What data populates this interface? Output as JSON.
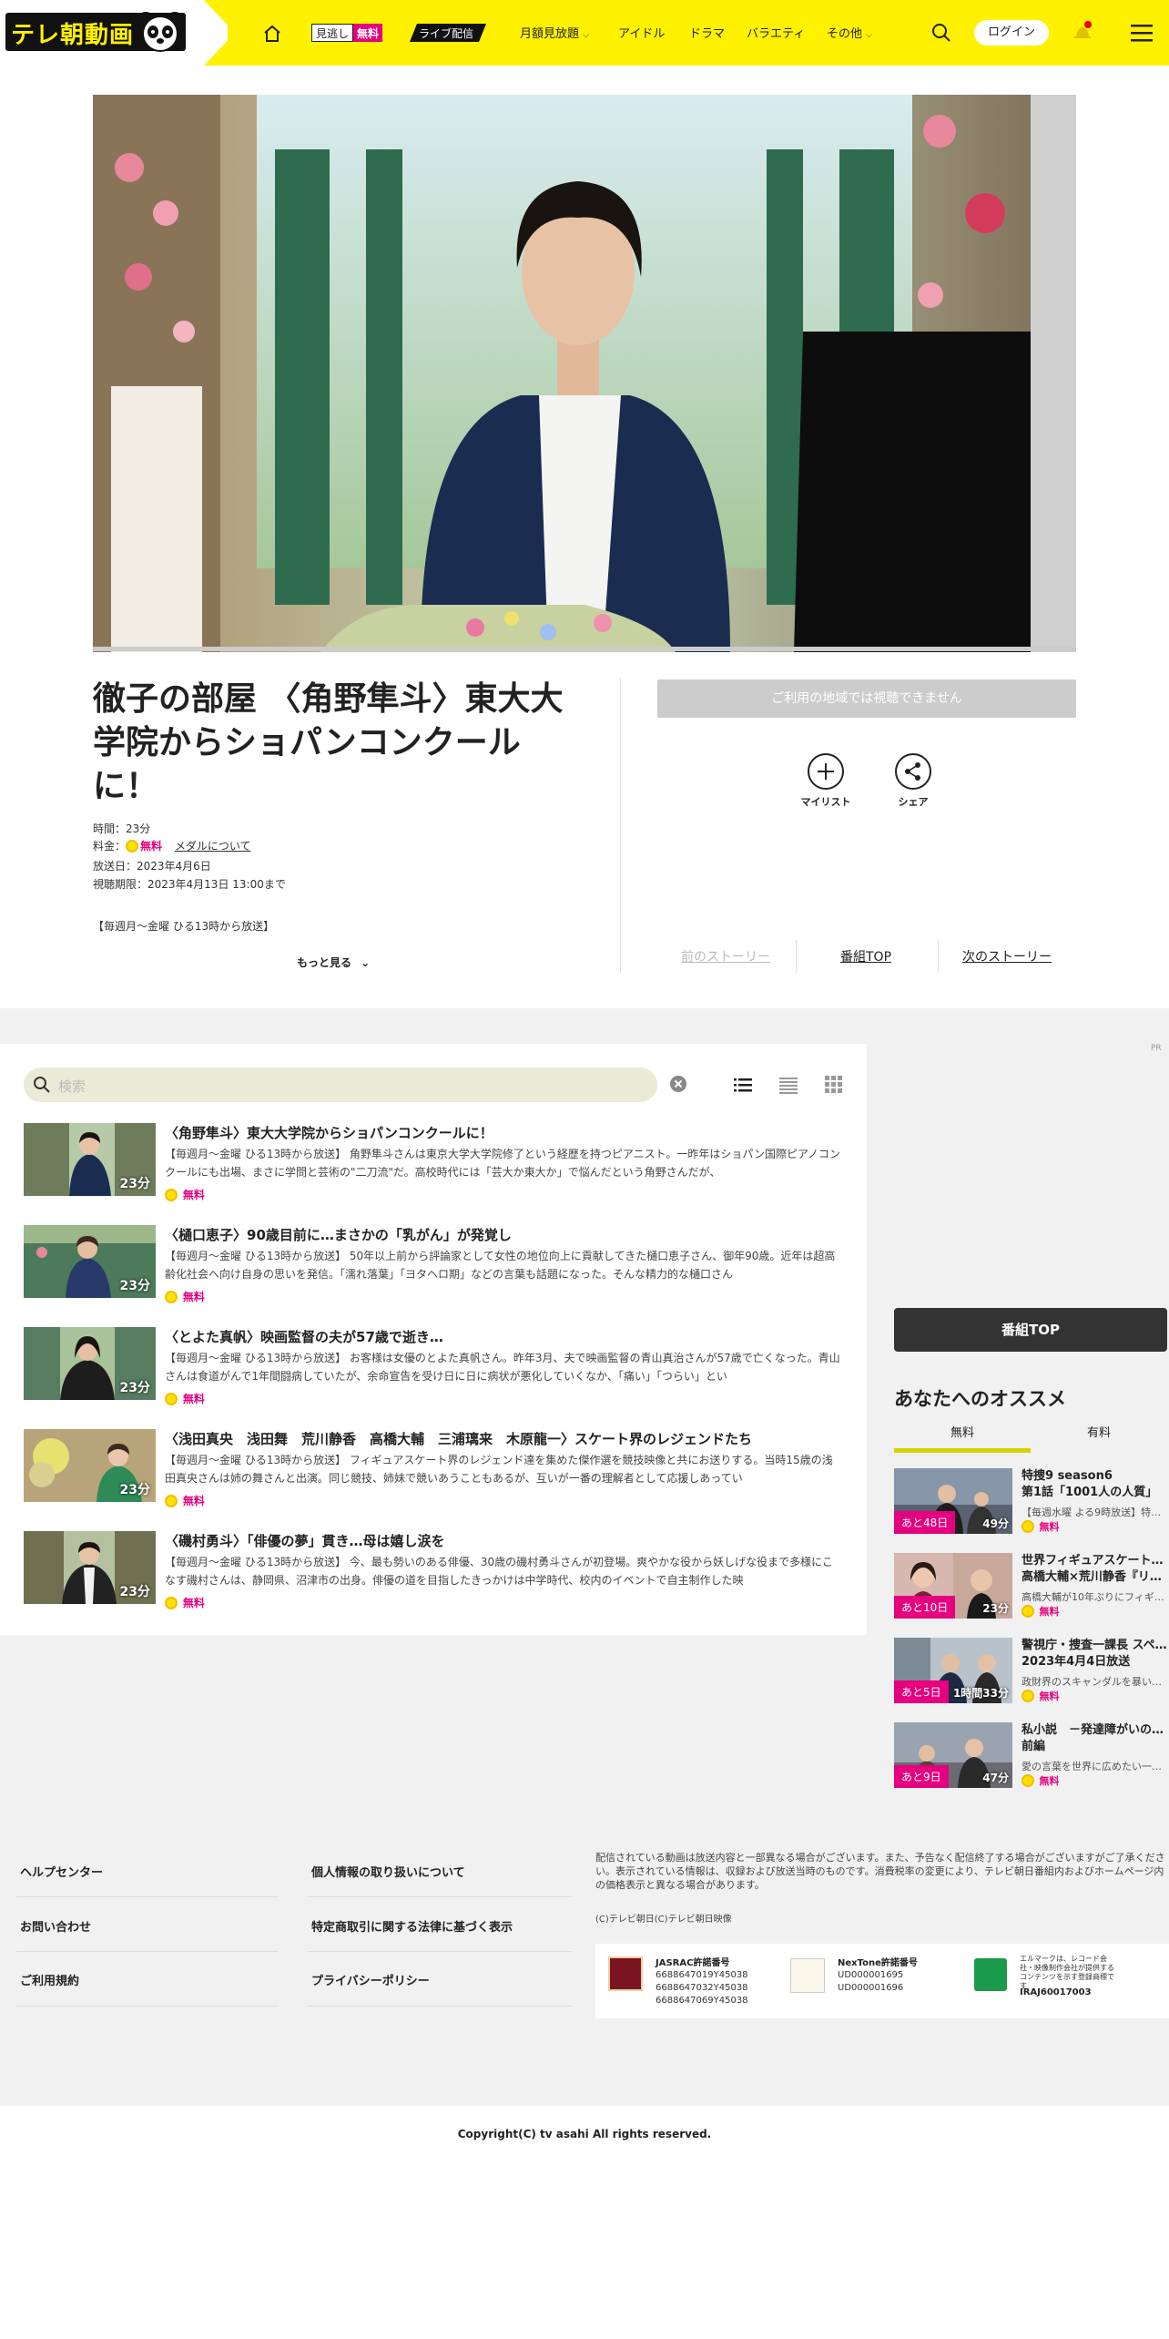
{
  "header": {
    "logo": "テレ朝動画",
    "mino": "見逃し",
    "mino_free": "無料",
    "live": "ライブ配信",
    "nav": [
      "月額見放題",
      "アイドル",
      "ドラマ",
      "バラエティ",
      "その他"
    ],
    "login": "ログイン",
    "colors": {
      "accent": "#fff100",
      "free": "#e4007f"
    }
  },
  "episode": {
    "title": "徹子の部屋 〈角野隼斗〉東大大学院からショパンコンクールに！",
    "time": "時間：23分",
    "price_label": "料金：",
    "price": "無料",
    "medal_link": "メダルについて",
    "air_date": "放送日：2023年4月6日",
    "expiry": "視聴期限：2023年4月13日 13:00まで",
    "schedule": "【毎週月～金曜 ひる13時から放送】",
    "more": "もっと見る",
    "unavailable": "ご利用の地域では視聴できません",
    "mylist": "マイリスト",
    "share": "シェア",
    "prev": "前のストーリー",
    "top": "番組TOP",
    "next": "次のストーリー"
  },
  "list": {
    "placeholder": "検索",
    "items": [
      {
        "title": "〈角野隼斗〉東大大学院からショパンコンクールに！",
        "desc": "【毎週月～金曜 ひる13時から放送】 角野隼斗さんは東京大学大学院修了という経歴を持つピアニスト。一昨年はショパン国際ピアノコンクールにも出場、まさに学問と芸術の\"二刀流\"だ。高校時代には「芸大か東大か」で悩んだという角野さんだが、",
        "duration": "23分",
        "price": "無料"
      },
      {
        "title": "〈樋口恵子〉90歳目前に…まさかの「乳がん」が発覚し",
        "desc": "【毎週月～金曜 ひる13時から放送】 50年以上前から評論家として女性の地位向上に貢献してきた樋口恵子さん、御年90歳。近年は超高齢化社会へ向け自身の思いを発信。「濡れ落葉」「ヨタヘロ期」などの言葉も話題になった。そんな精力的な樋口さん",
        "duration": "23分",
        "price": "無料"
      },
      {
        "title": "〈とよた真帆〉映画監督の夫が57歳で逝き…",
        "desc": "【毎週月～金曜 ひる13時から放送】 お客様は女優のとよた真帆さん。昨年3月、夫で映画監督の青山真治さんが57歳で亡くなった。青山さんは食道がんで1年間闘病していたが、余命宣告を受け日に日に病状が悪化していくなか、「痛い」「つらい」とい",
        "duration": "23分",
        "price": "無料"
      },
      {
        "title": "〈浅田真央　浅田舞　荒川静香　高橋大輔　三浦璃来　木原龍一〉スケート界のレジェンドたち",
        "desc": "【毎週月～金曜 ひる13時から放送】 フィギュアスケート界のレジェンド達を集めた傑作選を競技映像と共にお送りする。当時15歳の浅田真央さんは姉の舞さんと出演。同じ競技、姉妹で競いあうこともあるが、互いが一番の理解者として応援しあってい",
        "duration": "23分",
        "price": "無料"
      },
      {
        "title": "〈磯村勇斗〉「俳優の夢」貫き…母は嬉し涙を",
        "desc": "【毎週月～金曜 ひる13時から放送】 今、最も勢いのある俳優、30歳の磯村勇斗さんが初登場。爽やかな役から妖しげな役まで多様にこなす磯村さんは、静岡県、沼津市の出身。俳優の道を目指したきっかけは中学時代、校内のイベントで自主制作した映",
        "duration": "23分",
        "price": "無料"
      }
    ]
  },
  "side": {
    "pr": "PR",
    "top_button": "番組TOP",
    "rec_title": "あなたへのオススメ",
    "tabs": [
      "無料",
      "有料"
    ],
    "items": [
      {
        "title": "特捜9 season6 第1話「1001人の人質」",
        "title1": "特捜9 season6",
        "title2": "第1話「1001人の人質」",
        "desc": "【毎週水曜 よる9時放送】特…",
        "remain": "あと48日",
        "duration": "49分",
        "price": "無料"
      },
      {
        "title": "世界フィギュアスケート… 高橋大輔×荒川静香『リ…",
        "title1": "世界フィギュアスケート…",
        "title2": "高橋大輔×荒川静香『リ…",
        "desc": "高橋大輔が10年ぶりにフィギ…",
        "remain": "あと10日",
        "duration": "23分",
        "price": "無料"
      },
      {
        "title": "警視庁・捜査一課長 スペ… 2023年4月4日放送",
        "title1": "警視庁・捜査一課長 スペ…",
        "title2": "2023年4月4日放送",
        "desc": "政財界のスキャンダルを暴い…",
        "remain": "あと5日",
        "duration": "1時間33分",
        "price": "無料"
      },
      {
        "title": "私小説 －発達障がいの… 前編",
        "title1": "私小説　－発達障がいの…",
        "title2": "前編",
        "desc": "愛の言葉を世界に広めたい一…",
        "remain": "あと9日",
        "duration": "47分",
        "price": "無料"
      }
    ]
  },
  "footer": {
    "col1": [
      "ヘルプセンター",
      "お問い合わせ",
      "ご利用規約"
    ],
    "col2": [
      "個人情報の取り扱いについて",
      "特定商取引に関する法律に基づく表示",
      "プライバシーポリシー"
    ],
    "notice": "配信されている動画は放送内容と一部異なる場合がございます。また、予告なく配信終了する場合がございますがご了承ください。表示されている情報は、収録および放送当時のものです。消費税率の変更により、テレビ朝日番組内およびホームページ内の価格表示と異なる場合があります。",
    "credit": "(C)テレビ朝日(C)テレビ朝日映像",
    "jasrac_title": "JASRAC許諾番号",
    "jasrac": [
      "6688647019Y45038",
      "6688647032Y45038",
      "6688647069Y45038"
    ],
    "nextone_title": "NexTone許諾番号",
    "nextone": [
      "UD000001695",
      "UD000001696"
    ],
    "lmark_text": "エルマークは、レコード会社・映像制作会社が提供するコンテンツを示す登録商標です",
    "lmark_id": "IRAJ60017003",
    "copyright": "Copyright(C) tv asahi All rights reserved."
  }
}
